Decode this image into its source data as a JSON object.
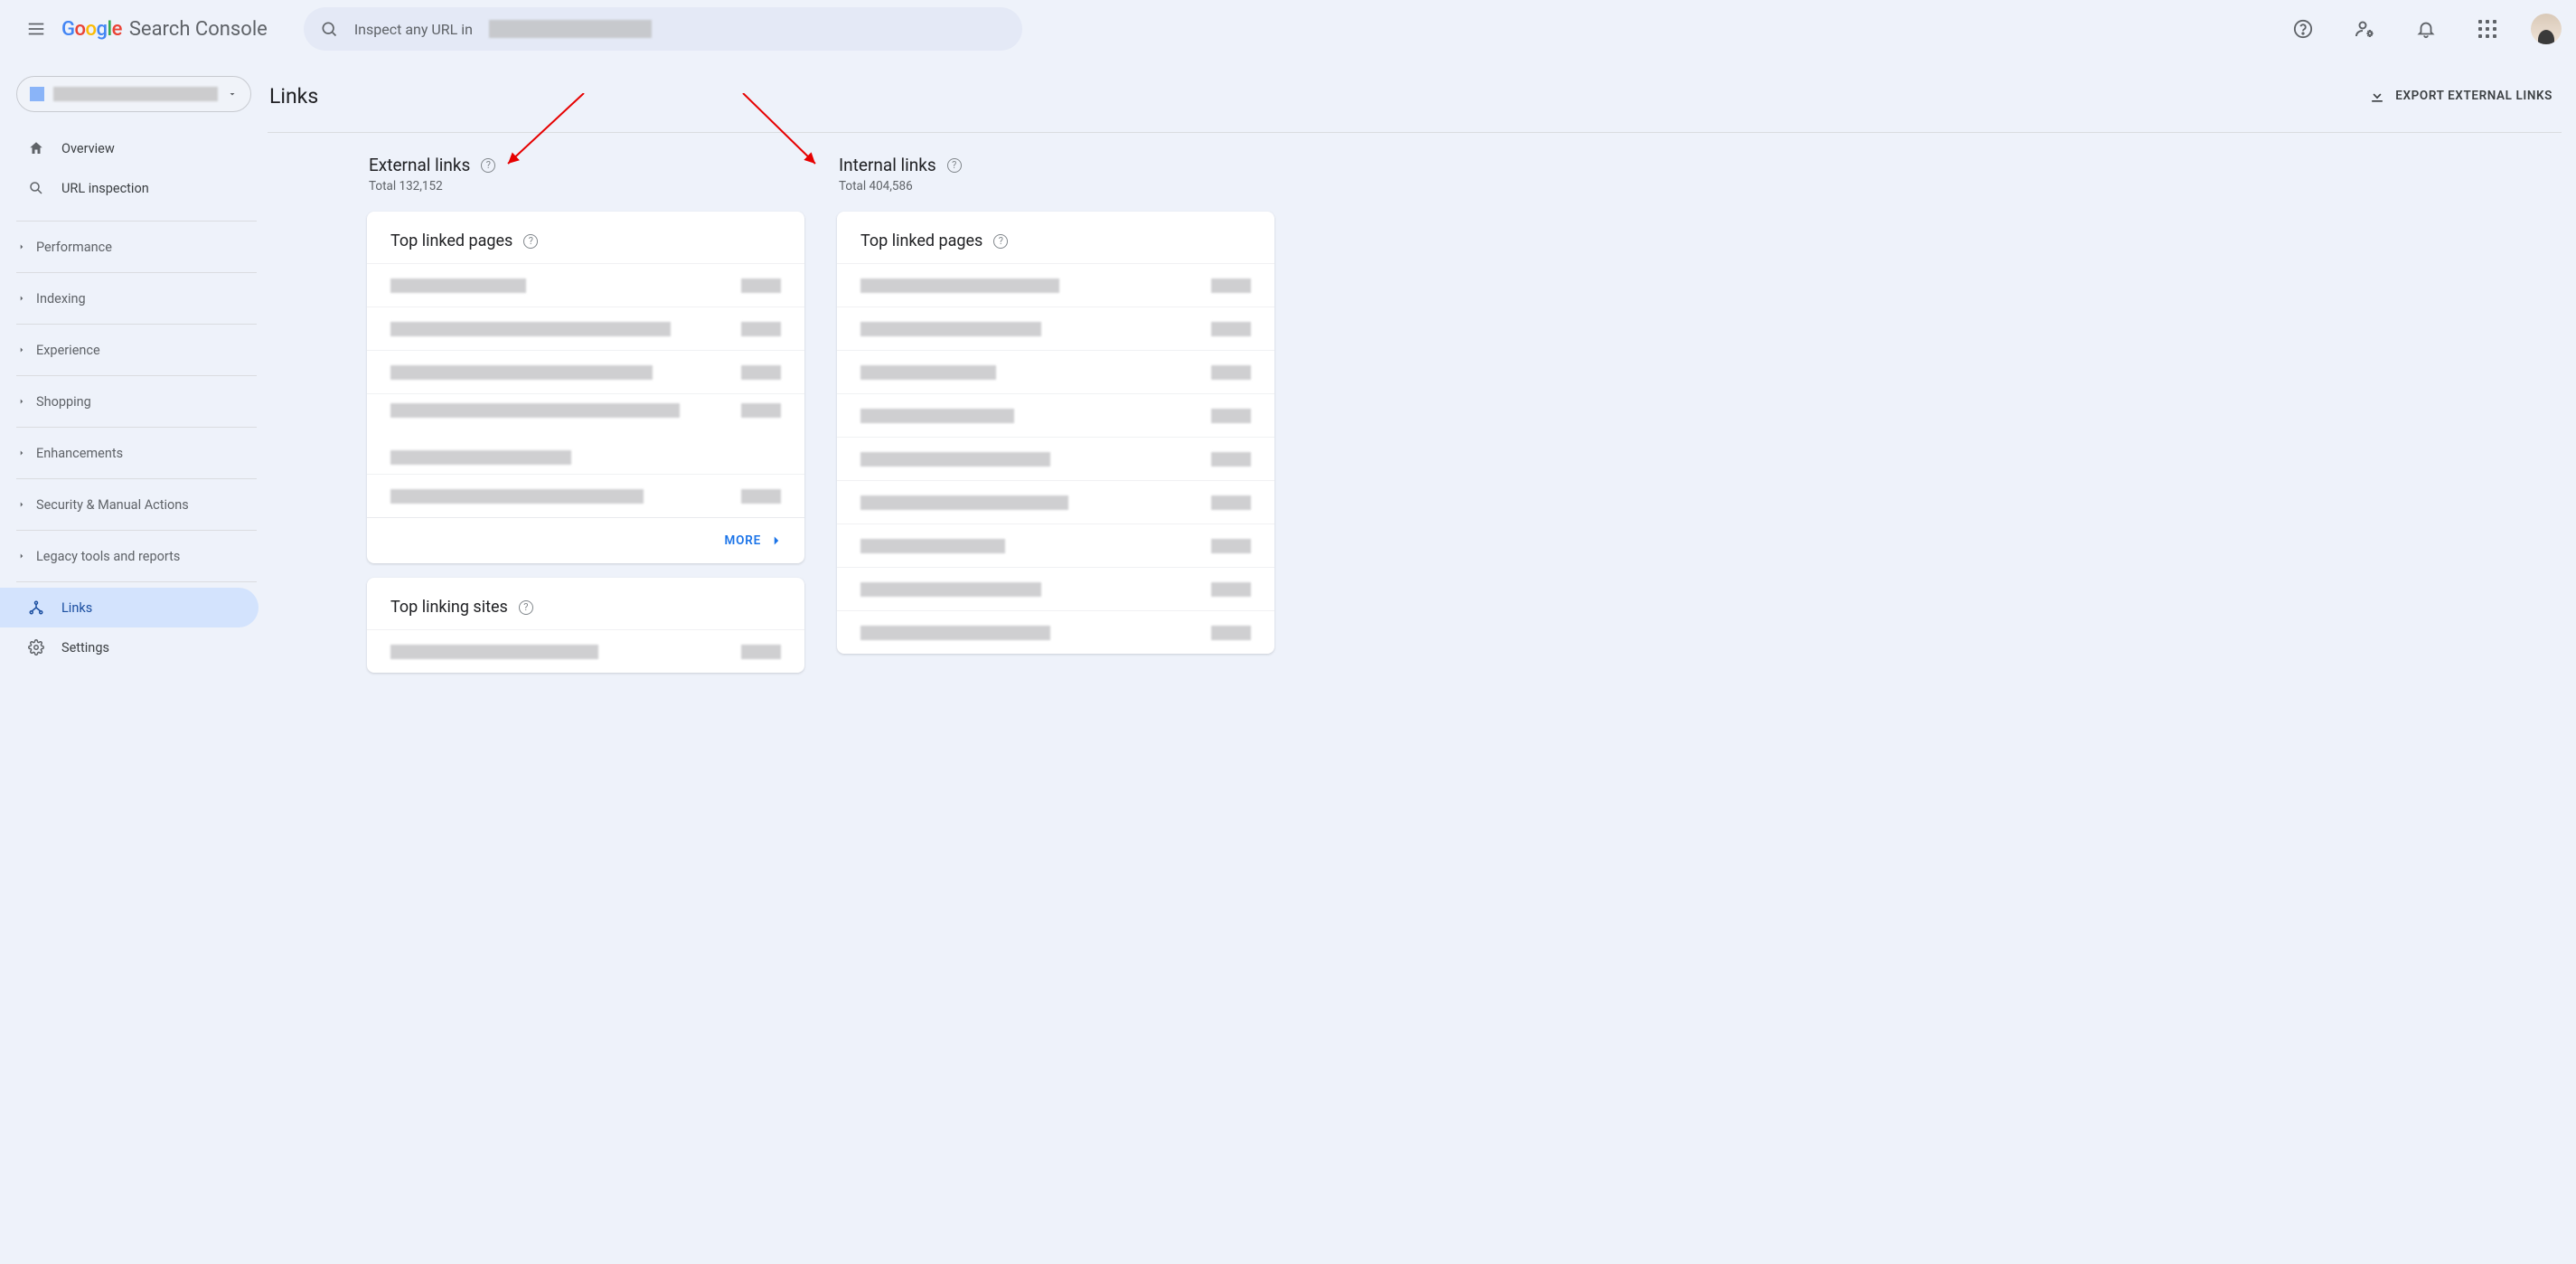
{
  "header": {
    "logo_product": "Search Console",
    "search_prefix": "Inspect any URL in "
  },
  "sidebar": {
    "overview": "Overview",
    "url_inspection": "URL inspection",
    "groups": {
      "performance": "Performance",
      "indexing": "Indexing",
      "experience": "Experience",
      "shopping": "Shopping",
      "enhancements": "Enhancements",
      "security": "Security & Manual Actions",
      "legacy": "Legacy tools and reports"
    },
    "links": "Links",
    "settings": "Settings"
  },
  "page": {
    "title": "Links",
    "export": "EXPORT EXTERNAL LINKS"
  },
  "external": {
    "title": "External links",
    "total_label": "Total 132,152",
    "card1_title": "Top linked pages",
    "more": "MORE",
    "card2_title": "Top linking sites"
  },
  "internal": {
    "title": "Internal links",
    "total_label": "Total 404,586",
    "card1_title": "Top linked pages"
  }
}
